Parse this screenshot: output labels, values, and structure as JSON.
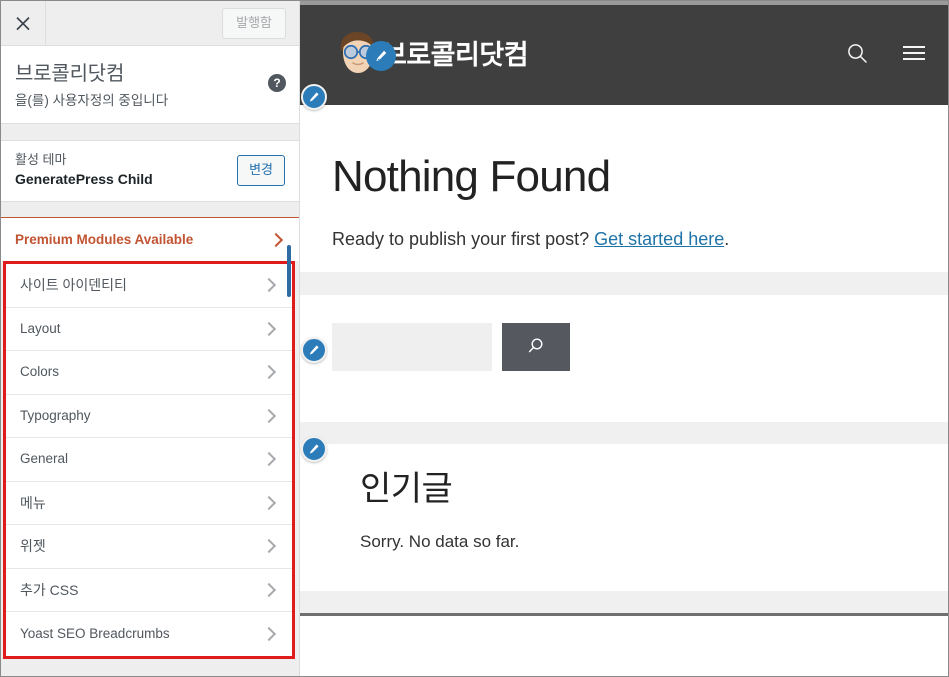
{
  "customizer": {
    "close_icon": "close-x-icon",
    "publish_button": "발행함",
    "title": "브로콜리닷컴",
    "subtitle": "을(를) 사용자정의 중입니다",
    "help_icon": "help-question-icon",
    "theme": {
      "label": "활성 테마",
      "name": "GeneratePress Child",
      "change_button": "변경"
    },
    "premium": {
      "label": "Premium Modules Available",
      "chevron_icon": "chevron-right-icon",
      "accent_color": "#c15432"
    },
    "highlight_color": "#e01b1b",
    "sections": [
      {
        "label": "사이트 아이덴티티",
        "lang": "ko"
      },
      {
        "label": "Layout",
        "lang": "en"
      },
      {
        "label": "Colors",
        "lang": "en"
      },
      {
        "label": "Typography",
        "lang": "en"
      },
      {
        "label": "General",
        "lang": "en"
      },
      {
        "label": "메뉴",
        "lang": "ko"
      },
      {
        "label": "위젯",
        "lang": "ko"
      },
      {
        "label": "추가 CSS",
        "lang": "ko"
      },
      {
        "label": "Yoast SEO Breadcrumbs",
        "lang": "en"
      }
    ]
  },
  "preview": {
    "header": {
      "background_color": "#3f3f3f",
      "logo_icon": "site-avatar-logo",
      "site_title": "브로콜리닷컴",
      "search_icon": "search-icon",
      "menu_icon": "hamburger-menu-icon",
      "edit_pin_icon": "pencil-edit-icon"
    },
    "main": {
      "heading": "Nothing Found",
      "prompt_text": "Ready to publish your first post?",
      "prompt_link": "Get started here",
      "prompt_suffix": "."
    },
    "search_widget": {
      "input_value": "",
      "input_placeholder": "",
      "submit_icon": "search-icon",
      "button_color": "#55595f"
    },
    "popular": {
      "heading": "인기글",
      "body": "Sorry. No data so far."
    }
  }
}
